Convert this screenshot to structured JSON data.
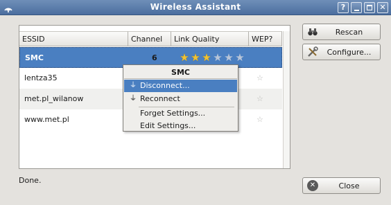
{
  "window": {
    "title": "Wireless Assistant",
    "help_glyph": "?",
    "close_glyph": "✕"
  },
  "table": {
    "columns": [
      "ESSID",
      "Channel",
      "Link Quality",
      "WEP?"
    ],
    "rows": [
      {
        "essid": "SMC",
        "channel": "6",
        "quality_stars": 3,
        "quality_max": 6,
        "selected": true
      },
      {
        "essid": "lentza35",
        "channel": "",
        "quality_stars": null,
        "selected": false
      },
      {
        "essid": "met.pl_wilanow",
        "channel": "",
        "quality_stars": null,
        "selected": false
      },
      {
        "essid": "www.met.pl",
        "channel": "",
        "quality_stars": null,
        "selected": false
      }
    ]
  },
  "status": "Done.",
  "buttons": {
    "rescan": "Rescan",
    "configure": "Configure...",
    "close": "Close"
  },
  "context_menu": {
    "title": "SMC",
    "items": [
      "Disconnect...",
      "Reconnect",
      "Forget Settings...",
      "Edit Settings..."
    ]
  },
  "colors": {
    "selection": "#4a7fc1",
    "titlebar": "#5b7eab",
    "star_on": "#f1c232",
    "star_off": "#b8c5d8"
  },
  "icons": {
    "app": "wireless-icon",
    "rescan": "binoculars-icon",
    "configure": "tools-icon",
    "close": "close-icon",
    "disconnect": "plug-icon",
    "reconnect": "plug-icon"
  }
}
